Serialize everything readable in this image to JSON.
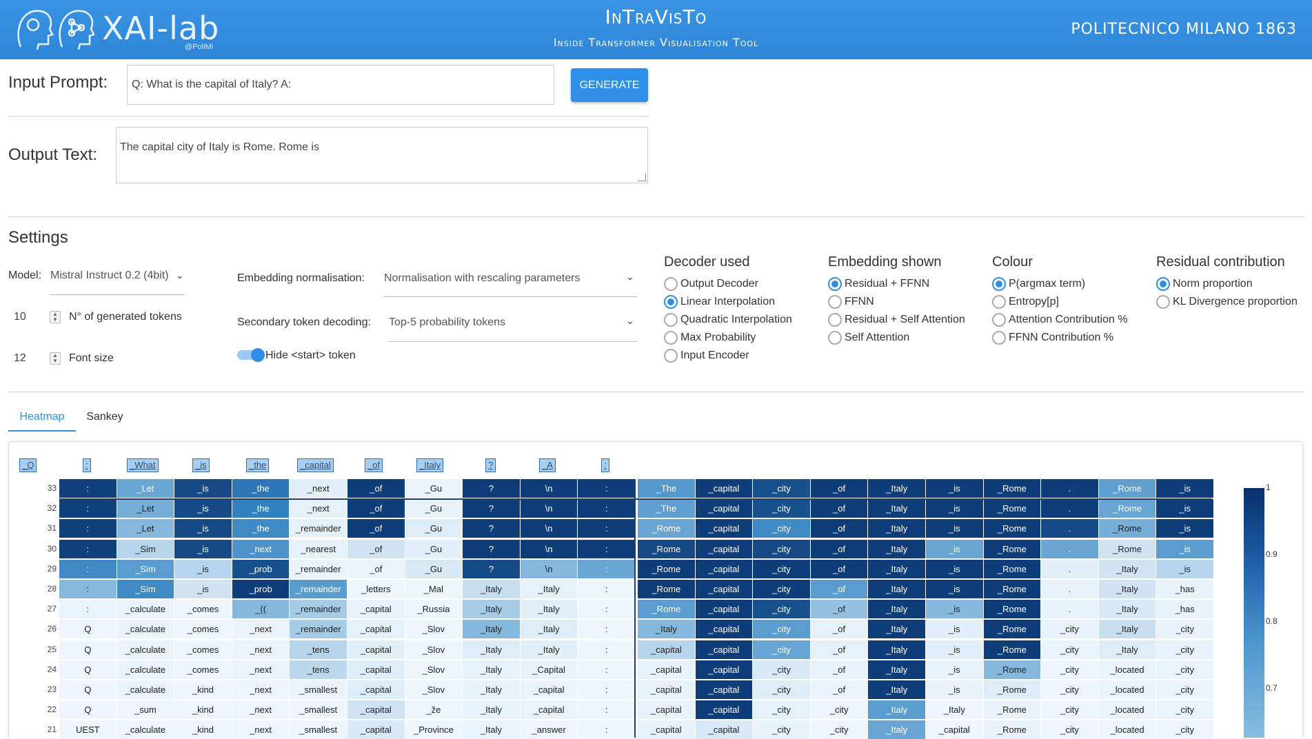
{
  "header": {
    "logo_text": "XAI-lab",
    "logo_sub": "@PoliMi",
    "app_title": "InTraVisTo",
    "app_subtitle": "Inside Transformer Visualisation Tool",
    "institution": "POLITECNICO MILANO 1863",
    "color": "#3a93e3"
  },
  "prompt": {
    "label": "Input Prompt:",
    "value": "Q: What is the capital of Italy? A:",
    "button": "GENERATE"
  },
  "output": {
    "label": "Output Text:",
    "value": "The capital city of Italy is Rome. Rome is"
  },
  "settings": {
    "title": "Settings",
    "model_label": "Model:",
    "model_value": "Mistral Instruct 0.2 (4bit)",
    "tokens_value": "10",
    "tokens_label": "N° of generated tokens",
    "font_value": "12",
    "font_label": "Font size",
    "norm_label": "Embedding normalisation:",
    "norm_value": "Normalisation with rescaling parameters",
    "secondary_label": "Secondary token decoding:",
    "secondary_value": "Top-5 probability tokens",
    "hide_label": "Hide <start> token",
    "groups": [
      {
        "title": "Decoder used",
        "options": [
          "Output Decoder",
          "Linear Interpolation",
          "Quadratic Interpolation",
          "Max Probability",
          "Input Encoder"
        ],
        "selected": 1
      },
      {
        "title": "Embedding shown",
        "options": [
          "Residual + FFNN",
          "FFNN",
          "Residual + Self Attention",
          "Self Attention"
        ],
        "selected": 0
      },
      {
        "title": "Colour",
        "options": [
          "P(argmax term)",
          "Entropy[p]",
          "Attention Contribution %",
          "FFNN Contribution %"
        ],
        "selected": 0
      },
      {
        "title": "Residual contribution",
        "options": [
          "Norm proportion",
          "KL Divergence proportion"
        ],
        "selected": 0
      }
    ]
  },
  "tabs": [
    "Heatmap",
    "Sankey"
  ],
  "heatmap": {
    "input_tokens": [
      "_Q",
      ":",
      "_What",
      "_is",
      "_the",
      "_capital",
      "_of",
      "_Italy",
      "?",
      "_A",
      ":"
    ],
    "rows": [
      {
        "layer": "33",
        "tokens": [
          ":",
          "_Let",
          "_is",
          "_the",
          "_next",
          "_of",
          "_Gu",
          "?",
          "\\n",
          ":",
          "_The",
          "_capital",
          "_city",
          "_of",
          "_Italy",
          "_is",
          "_Rome",
          ".",
          "_Rome",
          "_is"
        ],
        "levels": [
          0.95,
          0.55,
          0.92,
          0.78,
          0.1,
          0.96,
          0.05,
          0.96,
          0.96,
          0.96,
          0.62,
          0.96,
          0.9,
          0.96,
          0.96,
          0.96,
          0.96,
          0.96,
          0.58,
          0.96
        ]
      },
      {
        "layer": "32",
        "tokens": [
          ":",
          "_Let",
          "_is",
          "_the",
          "_next",
          "_of",
          "_Gu",
          "?",
          "\\n",
          ":",
          "_The",
          "_capital",
          "_city",
          "_of",
          "_Italy",
          "_is",
          "_Rome",
          ".",
          "_Rome",
          "_is"
        ],
        "levels": [
          0.95,
          0.5,
          0.92,
          0.75,
          0.08,
          0.96,
          0.06,
          0.96,
          0.96,
          0.96,
          0.58,
          0.96,
          0.9,
          0.96,
          0.96,
          0.96,
          0.96,
          0.96,
          0.55,
          0.96
        ]
      },
      {
        "layer": "31",
        "tokens": [
          ":",
          "_Let",
          "_is",
          "_the",
          "_remainder",
          "_of",
          "_Gu",
          "?",
          "\\n",
          ":",
          "_Rome",
          "_capital",
          "_city",
          "_of",
          "_Italy",
          "_is",
          "_Rome",
          ".",
          "_Rome",
          "_is"
        ],
        "levels": [
          0.95,
          0.45,
          0.92,
          0.7,
          0.08,
          0.96,
          0.12,
          0.96,
          0.96,
          0.96,
          0.55,
          0.96,
          0.7,
          0.96,
          0.96,
          0.96,
          0.96,
          0.92,
          0.5,
          0.96
        ]
      },
      {
        "layer": "30",
        "tokens": [
          ":",
          "_Sim",
          "_is",
          "_next",
          "_nearest",
          "_of",
          "_Gu",
          "?",
          "\\n",
          ":",
          "_Rome",
          "_capital",
          "_city",
          "_of",
          "_Italy",
          "_is",
          "_Rome",
          ".",
          "_Rome",
          "_is"
        ],
        "levels": [
          0.95,
          0.3,
          0.92,
          0.65,
          0.08,
          0.2,
          0.1,
          0.96,
          0.96,
          0.96,
          0.92,
          0.96,
          0.92,
          0.96,
          0.96,
          0.55,
          0.96,
          0.55,
          0.2,
          0.6
        ]
      },
      {
        "layer": "29",
        "tokens": [
          ":",
          "_Sim",
          "_is",
          "_prob",
          "_remainder",
          "_of",
          "_Gu",
          "?",
          "\\n",
          ":",
          "_Rome",
          "_capital",
          "_city",
          "_of",
          "_Italy",
          "_is",
          "_Rome",
          ".",
          "_Italy",
          "_is"
        ],
        "levels": [
          0.7,
          0.6,
          0.3,
          0.9,
          0.05,
          0.05,
          0.15,
          0.92,
          0.45,
          0.55,
          0.96,
          0.96,
          0.96,
          0.96,
          0.96,
          0.96,
          0.96,
          0.1,
          0.2,
          0.3
        ]
      },
      {
        "layer": "28",
        "tokens": [
          ":",
          "_Sim",
          "_is",
          "_prob",
          "_remainder",
          "_letters",
          "_Mal",
          "_Italy",
          "_Italy",
          ":",
          "_Rome",
          "_capital",
          "_city",
          "_of",
          "_Italy",
          "_is",
          "_Rome",
          ".",
          "_Italy",
          "_has"
        ],
        "levels": [
          0.45,
          0.7,
          0.2,
          0.96,
          0.6,
          0.03,
          0.03,
          0.25,
          0.08,
          0.03,
          0.96,
          0.96,
          0.96,
          0.6,
          0.96,
          0.96,
          0.96,
          0.06,
          0.2,
          0.06
        ]
      },
      {
        "layer": "27",
        "tokens": [
          ":",
          "_calculate",
          "_comes",
          "_((",
          "_remainder",
          "_capital",
          "_Russia",
          "_Italy",
          "_Italy",
          ":",
          "_Rome",
          "_capital",
          "_city",
          "_of",
          "_Italy",
          "_is",
          "_Rome",
          ".",
          "_Italy",
          "_has"
        ],
        "levels": [
          0.05,
          0.05,
          0.04,
          0.45,
          0.35,
          0.06,
          0.03,
          0.35,
          0.1,
          0.03,
          0.6,
          0.96,
          0.9,
          0.4,
          0.96,
          0.45,
          0.96,
          0.06,
          0.15,
          0.06
        ]
      },
      {
        "layer": "26",
        "tokens": [
          "Q",
          "_calculate",
          "_comes",
          "_next",
          "_remainder",
          "_capital",
          "_Slov",
          "_Italy",
          "_Italy",
          ":",
          "_Italy",
          "_capital",
          "_city",
          "_of",
          "_Italy",
          "_is",
          "_Rome",
          "_city",
          "_Italy",
          "_city"
        ],
        "levels": [
          0.04,
          0.05,
          0.04,
          0.05,
          0.35,
          0.08,
          0.03,
          0.45,
          0.12,
          0.03,
          0.45,
          0.96,
          0.6,
          0.08,
          0.96,
          0.1,
          0.96,
          0.06,
          0.25,
          0.06
        ]
      },
      {
        "layer": "25",
        "tokens": [
          "Q",
          "_calculate",
          "_comes",
          "_next",
          "_tens",
          "_capital",
          "_Slov",
          "_Italy",
          "_Italy",
          ":",
          "_capital",
          "_capital",
          "_city",
          "_of",
          "_Italy",
          "_is",
          "_Rome",
          "_city",
          "_Italy",
          "_city"
        ],
        "levels": [
          0.04,
          0.05,
          0.04,
          0.05,
          0.3,
          0.1,
          0.03,
          0.12,
          0.1,
          0.03,
          0.3,
          0.96,
          0.55,
          0.08,
          0.96,
          0.1,
          0.96,
          0.05,
          0.12,
          0.06
        ]
      },
      {
        "layer": "24",
        "tokens": [
          "Q",
          "_calculate",
          "_comes",
          "_next",
          "_tens",
          "_capital",
          "_Slov",
          "_Italy",
          "_Capital",
          ":",
          "_capital",
          "_capital",
          "_city",
          "_of",
          "_Italy",
          "_is",
          "_Rome",
          "_city",
          "_located",
          "_city"
        ],
        "levels": [
          0.04,
          0.05,
          0.04,
          0.05,
          0.28,
          0.12,
          0.03,
          0.08,
          0.06,
          0.03,
          0.06,
          0.96,
          0.15,
          0.06,
          0.96,
          0.06,
          0.45,
          0.04,
          0.05,
          0.05
        ]
      },
      {
        "layer": "23",
        "tokens": [
          "Q",
          "_calculate",
          "_kind",
          "_next",
          "_smallest",
          "_capital",
          "_Slov",
          "_Italy",
          "_capital",
          ":",
          "_capital",
          "_capital",
          "_city",
          "_of",
          "_Italy",
          "_is",
          "_Rome",
          "_city",
          "_located",
          "_city"
        ],
        "levels": [
          0.04,
          0.05,
          0.04,
          0.04,
          0.05,
          0.12,
          0.03,
          0.06,
          0.05,
          0.03,
          0.06,
          0.96,
          0.12,
          0.05,
          0.96,
          0.06,
          0.12,
          0.04,
          0.05,
          0.05
        ]
      },
      {
        "layer": "22",
        "tokens": [
          "Q",
          "_sum",
          "_kind",
          "_next",
          "_smallest",
          "_capital",
          "_že",
          "_Italy",
          "_capital",
          ":",
          "_capital",
          "_capital",
          "_city",
          "_city",
          "_Italy",
          "_Italy",
          "_Rome",
          "_city",
          "_located",
          "_city"
        ],
        "levels": [
          0.04,
          0.04,
          0.04,
          0.04,
          0.04,
          0.2,
          0.03,
          0.06,
          0.05,
          0.03,
          0.06,
          0.96,
          0.08,
          0.04,
          0.6,
          0.04,
          0.06,
          0.04,
          0.05,
          0.05
        ]
      },
      {
        "layer": "21",
        "tokens": [
          "UEST",
          "_calculate",
          "_kind",
          "_next",
          "_smallest",
          "_capital",
          "_Province",
          "_Italy",
          "_answer",
          ":",
          "_capital",
          "_capital",
          "_city",
          "_city",
          "_Italy",
          "_capital",
          "_Rome",
          "_city",
          "_located",
          "_city"
        ],
        "levels": [
          0.03,
          0.04,
          0.04,
          0.04,
          0.04,
          0.15,
          0.03,
          0.05,
          0.04,
          0.03,
          0.06,
          0.15,
          0.06,
          0.04,
          0.55,
          0.04,
          0.06,
          0.04,
          0.04,
          0.04
        ]
      }
    ],
    "colorbar_ticks": [
      "1",
      "0.9",
      "0.8",
      "0.7"
    ]
  }
}
